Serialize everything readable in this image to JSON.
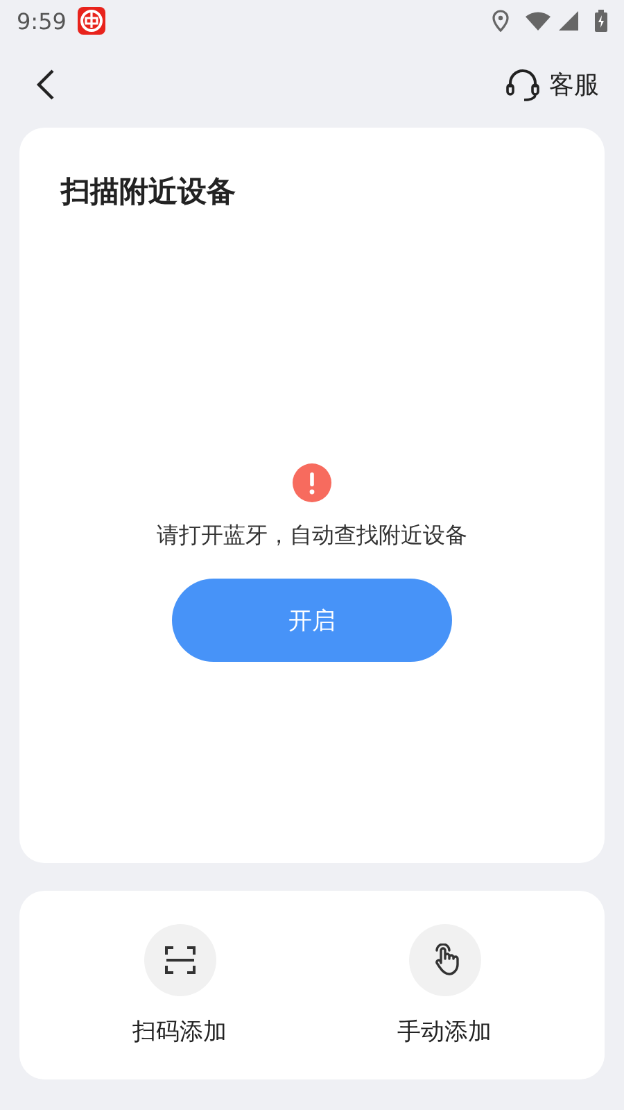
{
  "status_bar": {
    "time": "9:59"
  },
  "header": {
    "service_label": "客服"
  },
  "scan_card": {
    "title": "扫描附近设备",
    "message": "请打开蓝牙，自动查找附近设备",
    "button": "开启"
  },
  "actions": [
    {
      "kind": "scan",
      "label": "扫码添加"
    },
    {
      "kind": "manual",
      "label": "手动添加"
    }
  ]
}
